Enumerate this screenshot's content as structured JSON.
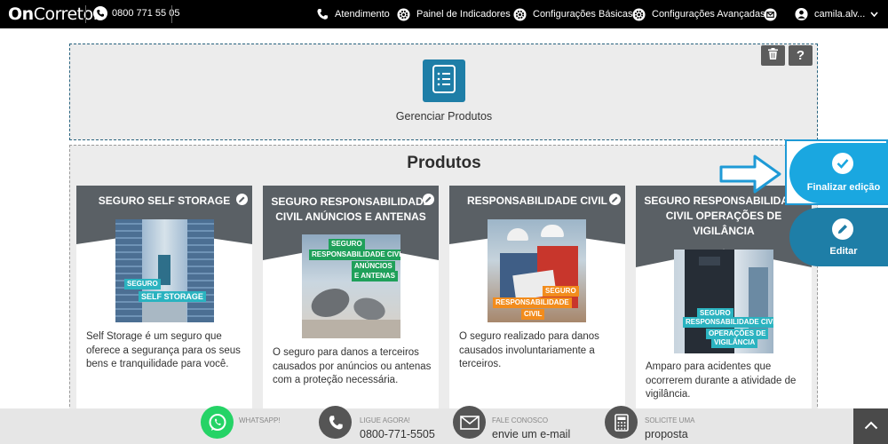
{
  "header": {
    "logo_bold": "On",
    "logo_rest": "Corretor",
    "phone": "0800 771 55 05",
    "nav": [
      {
        "label": "Atendimento",
        "icon": "phone-icon"
      },
      {
        "label": "Painel de Indicadores",
        "icon": "gear-icon"
      },
      {
        "label": "Configurações Básicas",
        "icon": "gear-icon"
      },
      {
        "label": "Configurações Avançadas",
        "icon": "gear-icon"
      },
      {
        "label": "",
        "icon": "mail-icon"
      },
      {
        "label": "camila.alv...",
        "icon": "user-icon"
      }
    ]
  },
  "banner": {
    "manage_label": "Gerenciar Produtos",
    "delete_icon": "trash-icon",
    "help_label": "?"
  },
  "products": {
    "title": "Produtos",
    "cards": [
      {
        "title": "SEGURO SELF STORAGE",
        "image_tags": [
          "SEGURO",
          "SELF STORAGE"
        ],
        "description": "Self Storage é um seguro que oferece a segurança para os seus bens e tranquilidade para você."
      },
      {
        "title": "SEGURO RESPONSABILIDADE CIVIL ANÚNCIOS E ANTENAS",
        "image_tags": [
          "SEGURO",
          "RESPONSABILIDADE CIVIL",
          "ANÚNCIOS",
          "E ANTENAS"
        ],
        "description": "O seguro para danos a terceiros causados por anúncios ou antenas com a proteção necessária."
      },
      {
        "title": "RESPONSABILIDADE CIVIL",
        "image_tags": [
          "SEGURO",
          "RESPONSABILIDADE",
          "CIVIL"
        ],
        "description": "O seguro realizado para danos causados involuntariamente a terceiros."
      },
      {
        "title": "SEGURO RESPONSABILIDADE CIVIL OPERAÇÕES DE VIGILÂNCIA",
        "image_tags": [
          "SEGURO",
          "RESPONSABILIDADE CIVIL",
          "OPERAÇÕES DE",
          "VIGILÂNCIA"
        ],
        "description": "Amparo para acidentes que ocorrerem durante a atividade de vigilância."
      }
    ]
  },
  "actions": {
    "finish_label": "Finalizar edição",
    "edit_label": "Editar"
  },
  "footer": {
    "items": [
      {
        "small": "WHATSAPP!",
        "big": ""
      },
      {
        "small": "LIGUE AGORA!",
        "big": "0800-771-5505"
      },
      {
        "small": "FALE CONOSCO",
        "big": "envie um e-mail"
      },
      {
        "small": "SOLICITE UMA",
        "big": "proposta"
      }
    ]
  },
  "colors": {
    "accent_blue": "#1aa7e0",
    "dark_blue": "#1e7ea7",
    "card_header": "#5a6065",
    "whatsapp_green": "#25d366"
  }
}
